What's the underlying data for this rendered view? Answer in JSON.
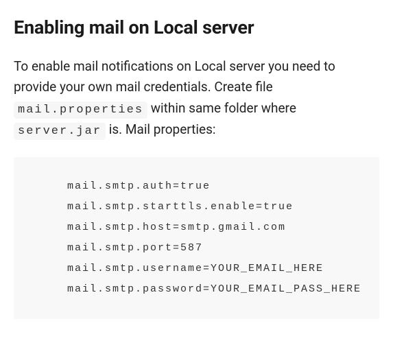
{
  "heading": "Enabling mail on Local server",
  "paragraph": {
    "part1": "To enable mail notifications on Local server you need to provide your own mail credentials. Create file ",
    "code1": "mail.properties",
    "part2": " within same folder where ",
    "code2": "server.jar",
    "part3": " is. Mail properties:"
  },
  "codeblock": "mail.smtp.auth=true\nmail.smtp.starttls.enable=true\nmail.smtp.host=smtp.gmail.com\nmail.smtp.port=587\nmail.smtp.username=YOUR_EMAIL_HERE\nmail.smtp.password=YOUR_EMAIL_PASS_HERE"
}
